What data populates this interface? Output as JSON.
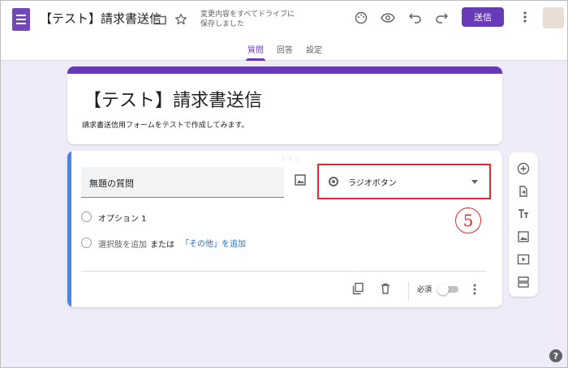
{
  "header": {
    "title": "【テスト】請求書送信",
    "save_note": "変更内容をすべてドライブに保存しました",
    "send_label": "送信"
  },
  "tabs": [
    {
      "label": "質問",
      "active": true
    },
    {
      "label": "回答",
      "active": false
    },
    {
      "label": "設定",
      "active": false
    }
  ],
  "form": {
    "title": "【テスト】請求書送信",
    "description": "請求書送信用フォームをテストで作成してみます。"
  },
  "question": {
    "title": "無題の質問",
    "type_label": "ラジオボタン",
    "options": [
      "オプション 1"
    ],
    "add_option": "選択肢を追加",
    "or_text": "または",
    "add_other": "「その他」を追加",
    "required_label": "必須",
    "required": false
  },
  "annotation": {
    "number": "5"
  },
  "colors": {
    "accent": "#673ab7",
    "focus_bar": "#4285f4",
    "annotation": "#e32a2a",
    "link": "#1a73e8"
  },
  "icons": {
    "header": [
      "folder-icon",
      "star-icon",
      "palette-icon",
      "eye-icon",
      "undo-icon",
      "redo-icon",
      "more-vert-icon"
    ],
    "sidebar": [
      "add-circle-icon",
      "import-icon",
      "title-icon",
      "image-icon",
      "video-icon",
      "section-icon"
    ]
  }
}
